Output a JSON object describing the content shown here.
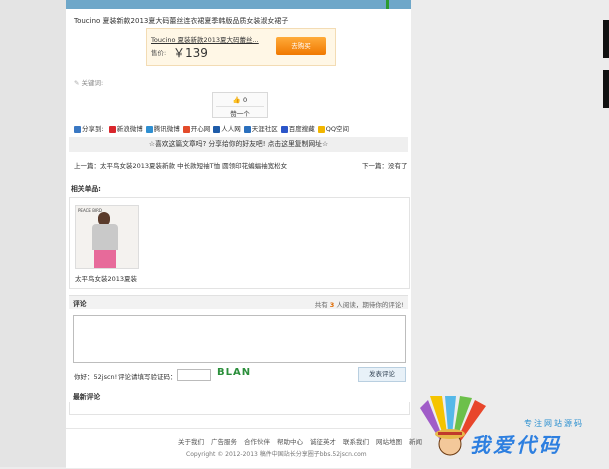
{
  "product": {
    "title": "Toucino 夏装新款2013夏大码蕾丝连衣裙夏季韩版品质女装淑女裙子",
    "buy_title": "Toucino 夏装新款2013夏大码蕾丝...",
    "price_label": "售价:",
    "price": "￥139",
    "buy_button": "去购买"
  },
  "keywords_label": "关键词:",
  "like": {
    "count": "0",
    "label": "赞一个"
  },
  "share": {
    "label": "分享到:",
    "items": [
      {
        "label": "新浪微博",
        "color": "#d9262c"
      },
      {
        "label": "腾讯微博",
        "color": "#2f8fd1"
      },
      {
        "label": "开心网",
        "color": "#e34b2a"
      },
      {
        "label": "人人网",
        "color": "#1e5ba8"
      },
      {
        "label": "天涯社区",
        "color": "#2a6fbd"
      },
      {
        "label": "百度搜藏",
        "color": "#2b55c9"
      },
      {
        "label": "QQ空间",
        "color": "#f2b600"
      }
    ]
  },
  "banner_text": "☆喜欢这篇文章吗? 分享给你的好友吧! 点击这里复制网址☆",
  "nav": {
    "prev": "上一篇：太平鸟女装2013夏装新款 中长款短袖T恤 圆领印花蝙蝠袖宽松女",
    "next": "下一篇：没有了"
  },
  "related": {
    "heading": "相关单品:",
    "thumb_text": "PEACE BIRD",
    "caption": "太平鸟女装2013夏装"
  },
  "comment": {
    "heading": "评论",
    "stats_prefix": "共有",
    "count": "3",
    "stats_suffix": "人阅读，期待你的评论!",
    "user_label": "你好：52jscn!",
    "code_label": "评论请填写验证码：",
    "captcha": "BLAN",
    "submit": "发表评论",
    "latest_heading": "最新评论"
  },
  "footer": {
    "links": [
      "关于我们",
      "广告服务",
      "合作伙伴",
      "帮助中心",
      "诚征英才",
      "联系我们",
      "网站地图",
      "新闻"
    ],
    "copyright": "Copyright © 2012-2013 稿件中国站长分享圈子bbs.52jscn.com"
  },
  "watermark": {
    "top": "专注网站源码",
    "main": "我爱代码"
  }
}
